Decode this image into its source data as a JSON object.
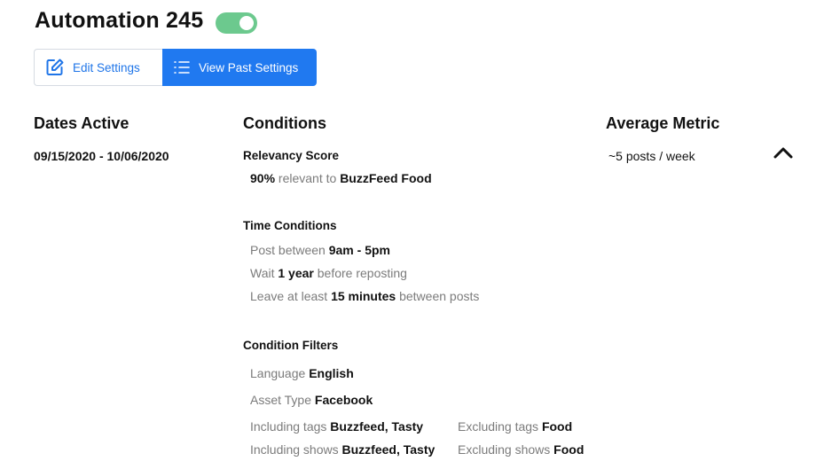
{
  "header": {
    "title": "Automation 245",
    "toggle_on": true,
    "toggle_color": "#6cc98e"
  },
  "buttons": {
    "edit": "Edit Settings",
    "view": "View Past Settings",
    "accent": "#2079f0"
  },
  "dates": {
    "heading": "Dates Active",
    "range": "09/15/2020 - 10/06/2020"
  },
  "conditions": {
    "heading": "Conditions",
    "relevancy": {
      "title": "Relevancy Score",
      "pct": "90%",
      "pre": "relevant to",
      "target": "BuzzFeed Food"
    },
    "time": {
      "title": "Time Conditions",
      "l1_pre": "Post between",
      "l1_val": "9am - 5pm",
      "l2_pre": "Wait",
      "l2_val": "1 year",
      "l2_post": "before reposting",
      "l3_pre": "Leave at least",
      "l3_val": "15 minutes",
      "l3_post": "between posts"
    },
    "filters": {
      "title": "Condition Filters",
      "language_label": "Language",
      "language": "English",
      "asset_label": "Asset Type",
      "asset": "Facebook",
      "inc_tags_label": "Including tags",
      "inc_tags": "Buzzfeed, Tasty",
      "exc_tags_label": "Excluding tags",
      "exc_tags": "Food",
      "inc_shows_label": "Including shows",
      "inc_shows": "Buzzfeed, Tasty",
      "exc_shows_label": "Excluding shows",
      "exc_shows": "Food"
    }
  },
  "metric": {
    "heading": "Average Metric",
    "value": "~5 posts / week",
    "collapse_icon": "chevron-up-icon"
  }
}
